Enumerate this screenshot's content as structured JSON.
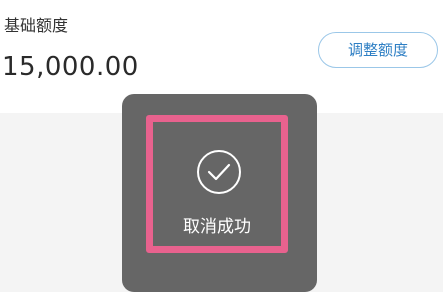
{
  "quota": {
    "label": "基础额度",
    "amount": "15,000.00",
    "adjust_button": "调整额度"
  },
  "toast": {
    "message": "取消成功",
    "icon": "check-circle-icon"
  },
  "colors": {
    "accent": "#2e7fc4",
    "button_border": "#9bc7e8",
    "toast_bg": "#666666",
    "highlight": "#e8628e"
  }
}
